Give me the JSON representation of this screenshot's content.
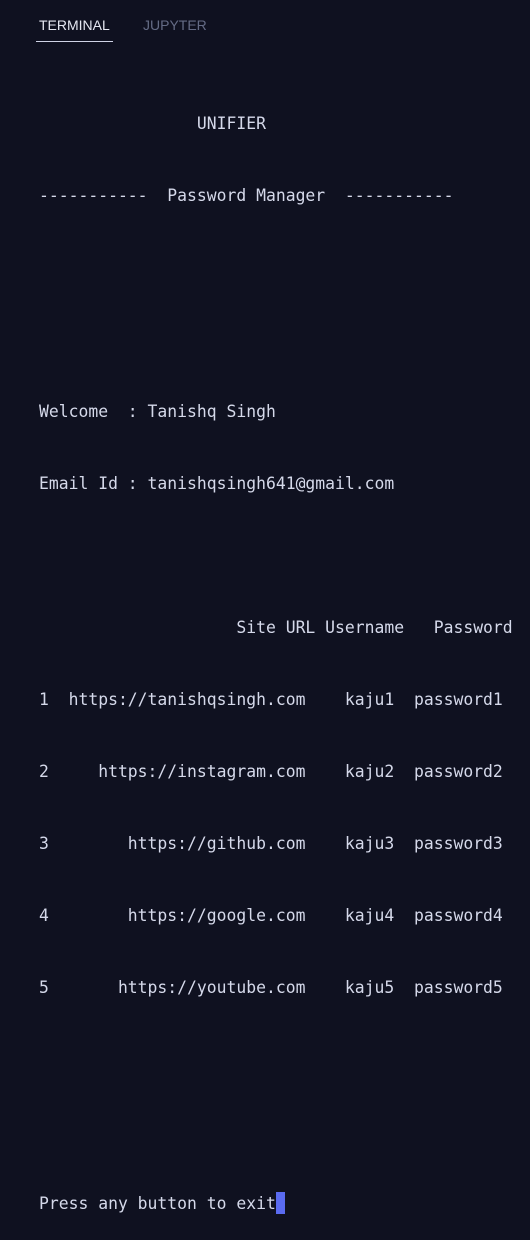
{
  "tabs": [
    {
      "label": "TERMINAL",
      "active": true
    },
    {
      "label": "JUPYTER",
      "active": false
    }
  ],
  "terminal": {
    "lines": [
      "                UNIFIER",
      "-----------  Password Manager  -----------",
      "",
      "",
      "Welcome  : Tanishq Singh",
      "Email Id : tanishqsingh641@gmail.com",
      "",
      "                    Site URL Username   Password",
      "1  https://tanishqsingh.com    kaju1  password1",
      "2     https://instagram.com    kaju2  password2",
      "3        https://github.com    kaju3  password3",
      "4        https://google.com    kaju4  password4",
      "5       https://youtube.com    kaju5  password5",
      "",
      "",
      "Press any button to exit"
    ]
  },
  "colors": {
    "background": "#0f1120",
    "text": "#d5d9ea",
    "cursor": "#5a6bf0",
    "tab_active": "#e6e8f2",
    "tab_inactive": "#646b85"
  }
}
